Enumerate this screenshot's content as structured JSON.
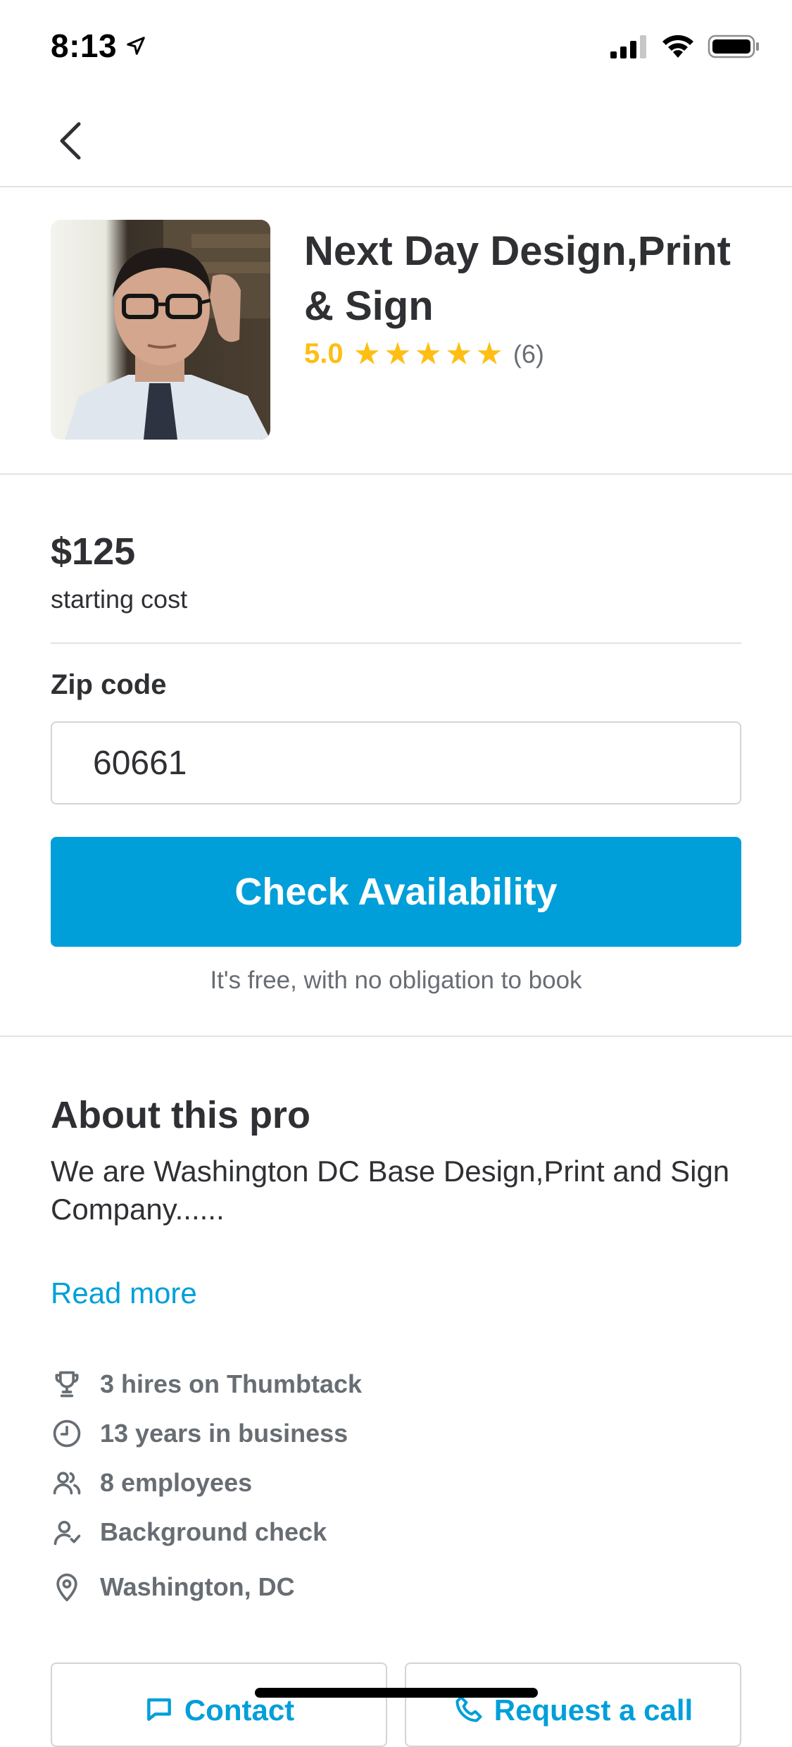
{
  "status_bar": {
    "time": "8:13"
  },
  "pro": {
    "name": "Next Day Design,Print & Sign",
    "rating": "5.0",
    "stars": 5,
    "review_count": "(6)"
  },
  "pricing": {
    "price": "$125",
    "caption": "starting cost"
  },
  "zip": {
    "label": "Zip code",
    "value": "60661"
  },
  "cta": {
    "label": "Check Availability",
    "note": "It's free, with no obligation to book"
  },
  "about": {
    "title": "About this pro",
    "text": "We are Washington DC Base Design,Print and Sign Company......",
    "read_more": "Read more",
    "facts": [
      {
        "icon": "trophy-icon",
        "text": "3 hires on Thumbtack"
      },
      {
        "icon": "clock-icon",
        "text": "13 years in business"
      },
      {
        "icon": "people-icon",
        "text": "8 employees"
      },
      {
        "icon": "person-check-icon",
        "text": "Background check"
      },
      {
        "icon": "location-pin-icon",
        "text": "Washington, DC"
      }
    ]
  },
  "actions": {
    "contact": "Contact",
    "request_call": "Request a call"
  },
  "colors": {
    "accent": "#009fd9",
    "star": "#febe14",
    "text": "#2f3033",
    "muted": "#676d73"
  }
}
